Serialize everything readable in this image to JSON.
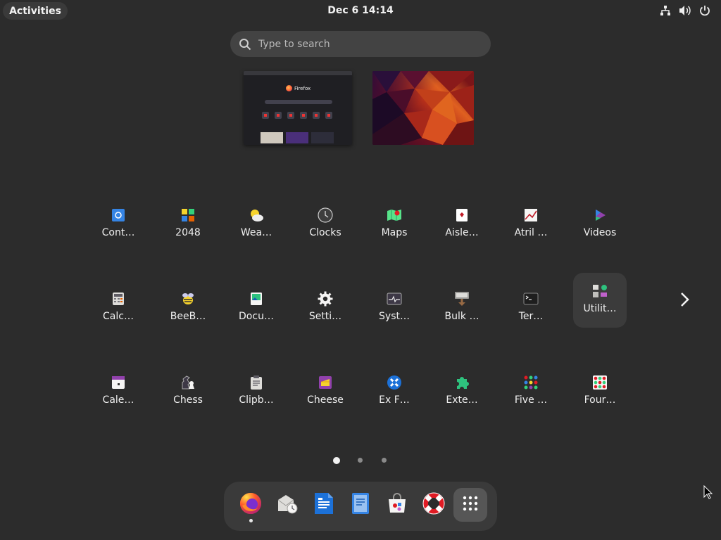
{
  "topbar": {
    "activities_label": "Activities",
    "clock": "Dec 6  14:14",
    "tray_icons": [
      "network-icon",
      "volume-icon",
      "power-icon"
    ]
  },
  "search": {
    "placeholder": "Type to search",
    "value": ""
  },
  "workspaces": [
    {
      "window": "Firefox",
      "title": "Firefox"
    },
    {
      "window": "wallpaper"
    }
  ],
  "apps": [
    {
      "label": "Cont…",
      "icon": "contacts-icon"
    },
    {
      "label": "2048",
      "icon": "2048-icon"
    },
    {
      "label": "Wea…",
      "icon": "weather-icon"
    },
    {
      "label": "Clocks",
      "icon": "clocks-icon"
    },
    {
      "label": "Maps",
      "icon": "maps-icon"
    },
    {
      "label": "Aisle…",
      "icon": "aisleriot-icon"
    },
    {
      "label": "Atril …",
      "icon": "atril-icon"
    },
    {
      "label": "Videos",
      "icon": "videos-icon"
    },
    {
      "label": "Calc…",
      "icon": "calculator-icon"
    },
    {
      "label": "BeeB…",
      "icon": "beebeep-icon"
    },
    {
      "label": "Docu…",
      "icon": "document-viewer-icon"
    },
    {
      "label": "Setti…",
      "icon": "settings-icon"
    },
    {
      "label": "Syst…",
      "icon": "system-monitor-icon"
    },
    {
      "label": "Bulk …",
      "icon": "bulk-rename-icon"
    },
    {
      "label": "Ter…",
      "icon": "terminal-icon"
    },
    {
      "label": "Utilit…",
      "icon": "utilities-folder-icon"
    },
    {
      "label": "Cale…",
      "icon": "calendar-icon"
    },
    {
      "label": "Chess",
      "icon": "chess-icon"
    },
    {
      "label": "Clipb…",
      "icon": "clipboard-icon"
    },
    {
      "label": "Cheese",
      "icon": "cheese-icon"
    },
    {
      "label": "Ex F…",
      "icon": "ex-falso-icon"
    },
    {
      "label": "Exte…",
      "icon": "extensions-icon"
    },
    {
      "label": "Five …",
      "icon": "five-or-more-icon"
    },
    {
      "label": "Four…",
      "icon": "four-in-a-row-icon"
    }
  ],
  "pagination": {
    "pages": 3,
    "current": 1
  },
  "dock": [
    {
      "app": "Firefox",
      "icon": "firefox-icon",
      "running": true
    },
    {
      "app": "Evolution",
      "icon": "mail-clock-icon"
    },
    {
      "app": "Writer",
      "icon": "writer-icon"
    },
    {
      "app": "Text Editor",
      "icon": "text-editor-icon"
    },
    {
      "app": "Software",
      "icon": "software-icon"
    },
    {
      "app": "Help",
      "icon": "help-icon"
    },
    {
      "app": "Show Applications",
      "icon": "app-grid-icon"
    }
  ],
  "colors": {
    "background": "#2c2c2c",
    "dock": "#3a3a3a",
    "search": "#434343",
    "accent": "#3584e4"
  }
}
